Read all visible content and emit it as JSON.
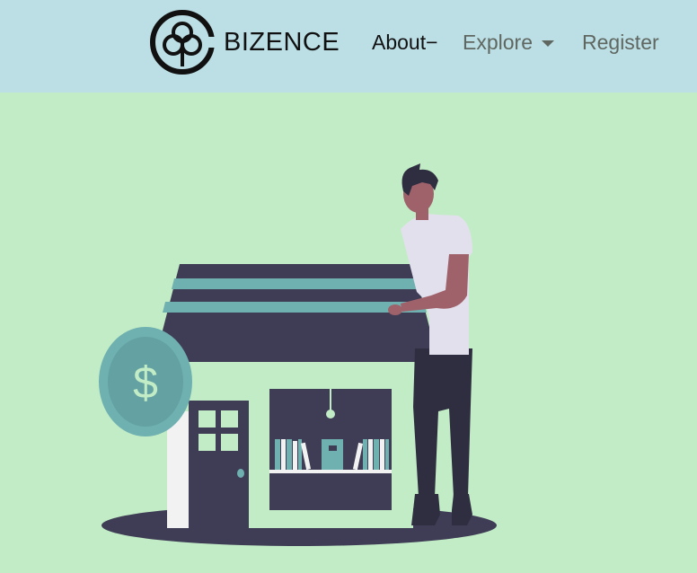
{
  "brand": {
    "name": "BIZENCE",
    "logo_icon": "intertwined-circles-logo"
  },
  "nav": {
    "about_label": "About−",
    "explore_label": "Explore",
    "register_label": "Register"
  },
  "colors": {
    "navbar_bg": "#bcdfe6",
    "page_bg": "#c2ecc5",
    "house_dark": "#3f3d56",
    "roof_stripe": "#6fb0b1",
    "coin": "#6fb0b1"
  },
  "illustration": {
    "subject": "shop-owner-with-storefront-illustration",
    "coin_symbol": "$"
  }
}
